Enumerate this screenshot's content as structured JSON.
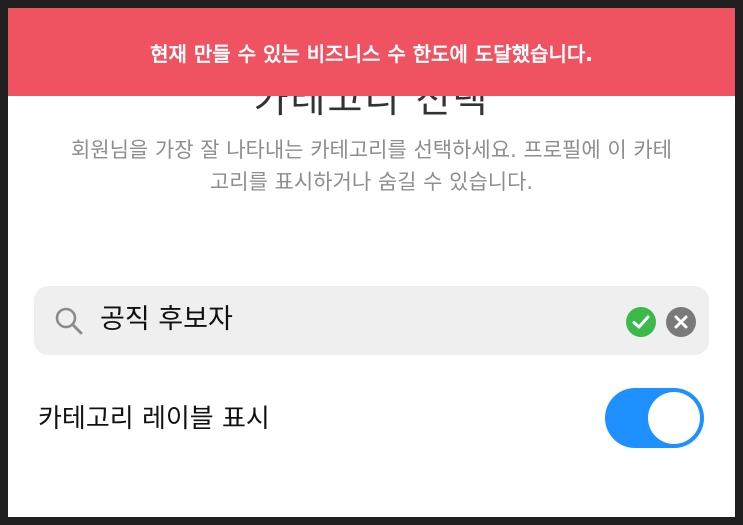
{
  "header": {
    "title": "카테고리 선택",
    "description": "회원님을 가장 잘 나타내는 카테고리를 선택하세요. 프로필에 이 카테고리를 표시하거나 숨길 수 있습니다."
  },
  "banner": {
    "message": "현재 만들 수 있는 비즈니스 수 한도에 도달했습니다.",
    "color": "#ef5361"
  },
  "search": {
    "value": "공직 후보자",
    "icon": "search-icon",
    "status_icon": "check-circle-icon",
    "clear_icon": "clear-icon"
  },
  "settings": {
    "show_category_label": {
      "label": "카테고리 레이블 표시",
      "enabled": true,
      "accent": "#1e90ff"
    }
  }
}
